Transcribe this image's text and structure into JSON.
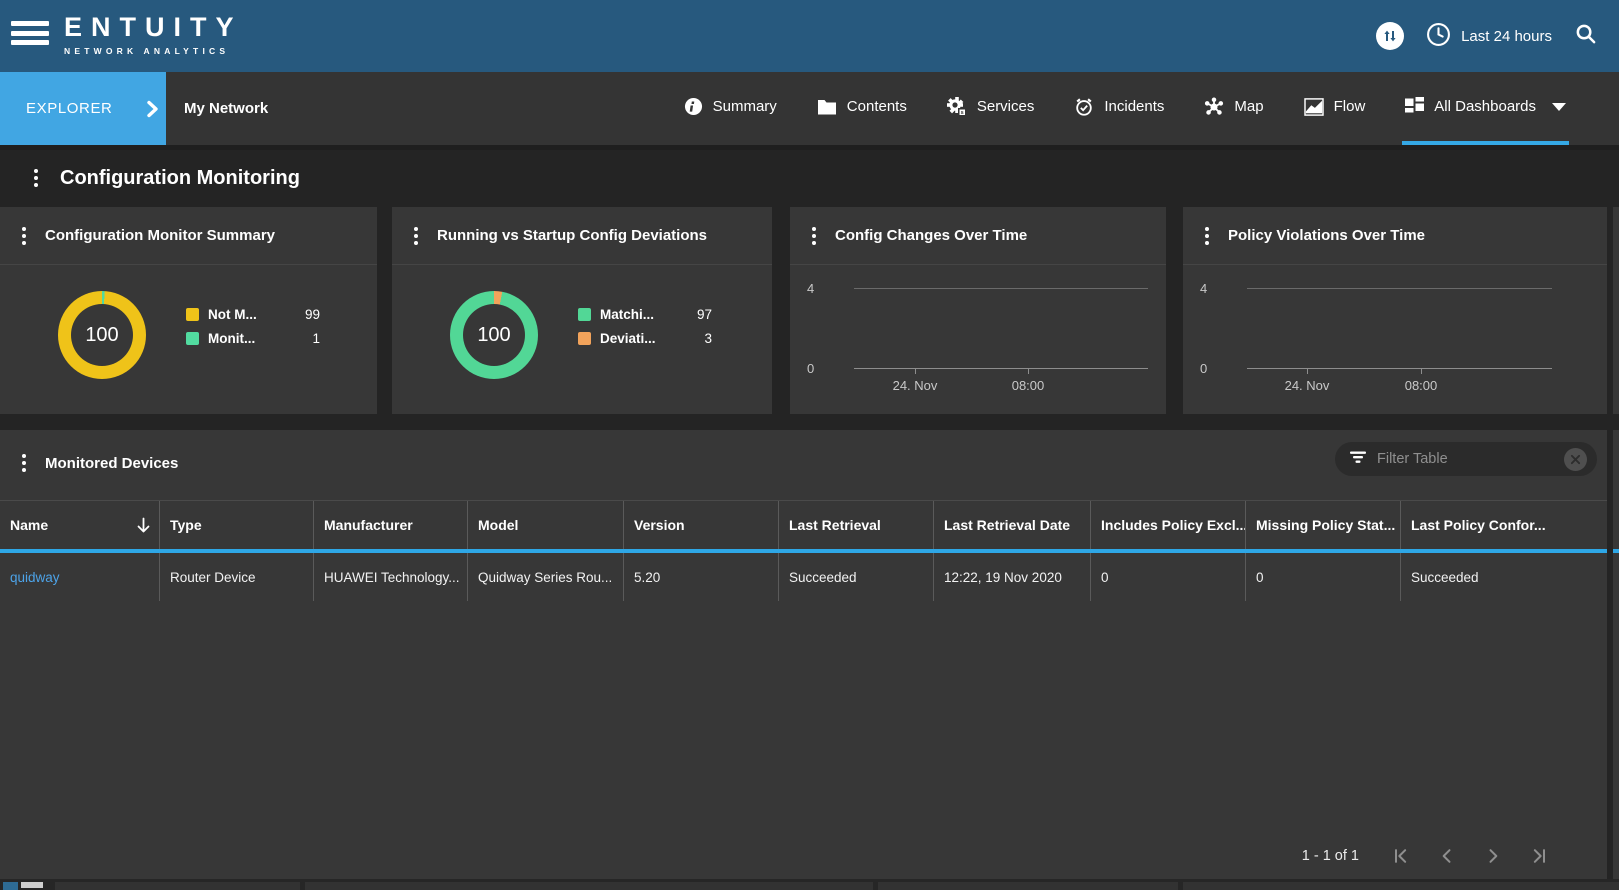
{
  "header": {
    "logo_title": "ENTUITY",
    "logo_subtitle": "NETWORK ANALYTICS",
    "time_range": "Last 24 hours"
  },
  "nav": {
    "explorer_label": "EXPLORER",
    "context_label": "My Network",
    "tabs": [
      {
        "label": "Summary",
        "icon": "info-icon",
        "active": false
      },
      {
        "label": "Contents",
        "icon": "folder-icon",
        "active": false
      },
      {
        "label": "Services",
        "icon": "services-gear-icon",
        "active": false
      },
      {
        "label": "Incidents",
        "icon": "alarm-clock-icon",
        "active": false
      },
      {
        "label": "Map",
        "icon": "map-nodes-icon",
        "active": false
      },
      {
        "label": "Flow",
        "icon": "flow-chart-icon",
        "active": false
      },
      {
        "label": "All Dashboards",
        "icon": "dashboards-grid-icon",
        "active": true,
        "has_caret": true
      }
    ]
  },
  "page": {
    "title": "Configuration Monitoring"
  },
  "colors": {
    "accent_blue": "#41a6e3",
    "active_tab_underline": "#35a8e5",
    "table_header_underline": "#2ea7e6",
    "link_blue": "#4da3e8",
    "donut_yellow": "#efc319",
    "donut_green": "#52d796",
    "donut_orange": "#f2a35b"
  },
  "chart_data": [
    {
      "type": "pie",
      "title": "Configuration Monitor Summary",
      "center_label": "100",
      "legend_position": "right",
      "slices": [
        {
          "label": "Not M...",
          "value": 99,
          "color": "#efc319"
        },
        {
          "label": "Monit...",
          "value": 1,
          "color": "#52dba0"
        }
      ]
    },
    {
      "type": "pie",
      "title": "Running vs Startup Config Deviations",
      "center_label": "100",
      "legend_position": "right",
      "slices": [
        {
          "label": "Matchi...",
          "value": 97,
          "color": "#52d796"
        },
        {
          "label": "Deviati...",
          "value": 3,
          "color": "#f2a35b"
        }
      ]
    },
    {
      "type": "line",
      "title": "Config Changes Over Time",
      "yticks": [
        "4",
        "0"
      ],
      "xticks": [
        "24. Nov",
        "08:00"
      ],
      "ylim": [
        0,
        4
      ],
      "grid": true,
      "series": []
    },
    {
      "type": "line",
      "title": "Policy Violations Over Time",
      "yticks": [
        "4",
        "0"
      ],
      "xticks": [
        "24. Nov",
        "08:00"
      ],
      "ylim": [
        0,
        4
      ],
      "grid": true,
      "series": []
    }
  ],
  "table": {
    "title": "Monitored Devices",
    "filter_placeholder": "Filter Table",
    "columns": [
      "Name",
      "Type",
      "Manufacturer",
      "Model",
      "Version",
      "Last Retrieval",
      "Last Retrieval Date",
      "Includes Policy Excl...",
      "Missing Policy Stat...",
      "Last Policy Confor..."
    ],
    "rows": [
      [
        "quidway",
        "Router Device",
        "HUAWEI Technology...",
        "Quidway Series Rou...",
        "5.20",
        "Succeeded",
        "12:22, 19 Nov 2020",
        "0",
        "0",
        "Succeeded"
      ]
    ],
    "pagination": {
      "label": "1 - 1 of 1"
    }
  }
}
